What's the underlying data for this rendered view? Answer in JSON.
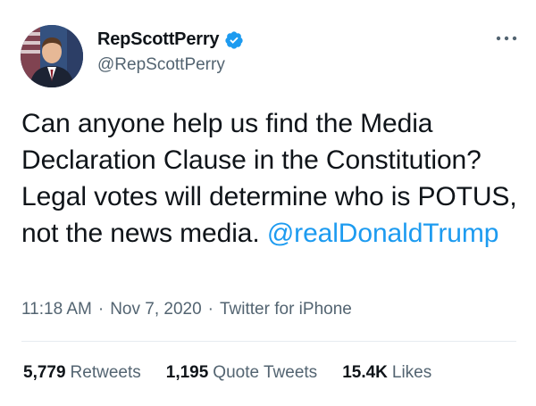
{
  "author": {
    "display_name": "RepScottPerry",
    "handle": "@RepScottPerry",
    "verified": true,
    "verified_icon": "verified-badge-icon",
    "avatar_icon": "profile-photo"
  },
  "tweet": {
    "text_before_mention": "Can anyone help us find the Media Declaration Clause in the Constitution? Legal votes will determine who is POTUS, not the news media. ",
    "mention": "@realDonaldTrump",
    "time": "11:18 AM",
    "date": "Nov 7, 2020",
    "separator": "·",
    "client": "Twitter for iPhone"
  },
  "stats": {
    "retweets": {
      "value": "5,779",
      "label": "Retweets"
    },
    "quote_tweets": {
      "value": "1,195",
      "label": "Quote Tweets"
    },
    "likes": {
      "value": "15.4K",
      "label": "Likes"
    }
  },
  "colors": {
    "accent": "#1d9bf0",
    "text_primary": "#0f1419",
    "text_secondary": "#536471",
    "divider": "#e6ecf0"
  },
  "more_icon": "more-options-icon"
}
